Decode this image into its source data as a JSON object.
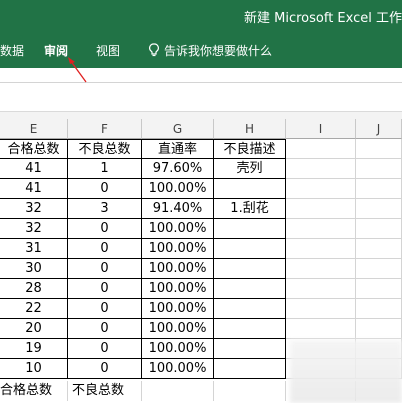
{
  "window": {
    "title": "新建 Microsoft Excel 工作"
  },
  "ribbon": {
    "tabs": [
      {
        "label": "数据"
      },
      {
        "label": "审阅"
      },
      {
        "label": "视图"
      }
    ],
    "tell_me": "告诉我你想要做什么",
    "tell_me_icon": "lightbulb-icon"
  },
  "columns": [
    "E",
    "F",
    "G",
    "H",
    "I",
    "J"
  ],
  "header_row": [
    "合格总数",
    "不良总数",
    "直通率",
    "不良描述"
  ],
  "rows": [
    {
      "e": "41",
      "f": "1",
      "g": "97.60%",
      "h": "壳列"
    },
    {
      "e": "41",
      "f": "0",
      "g": "100.00%",
      "h": ""
    },
    {
      "e": "32",
      "f": "3",
      "g": "91.40%",
      "h": "1.刮花"
    },
    {
      "e": "32",
      "f": "0",
      "g": "100.00%",
      "h": ""
    },
    {
      "e": "31",
      "f": "0",
      "g": "100.00%",
      "h": ""
    },
    {
      "e": "30",
      "f": "0",
      "g": "100.00%",
      "h": ""
    },
    {
      "e": "28",
      "f": "0",
      "g": "100.00%",
      "h": ""
    },
    {
      "e": "22",
      "f": "0",
      "g": "100.00%",
      "h": ""
    },
    {
      "e": "20",
      "f": "0",
      "g": "100.00%",
      "h": ""
    },
    {
      "e": "19",
      "f": "0",
      "g": "100.00%",
      "h": ""
    },
    {
      "e": "10",
      "f": "0",
      "g": "100.00%",
      "h": ""
    }
  ],
  "footer_row": [
    "合格总数",
    "不良总数"
  ],
  "colors": {
    "accent": "#217346",
    "annotation": "#e02020"
  }
}
